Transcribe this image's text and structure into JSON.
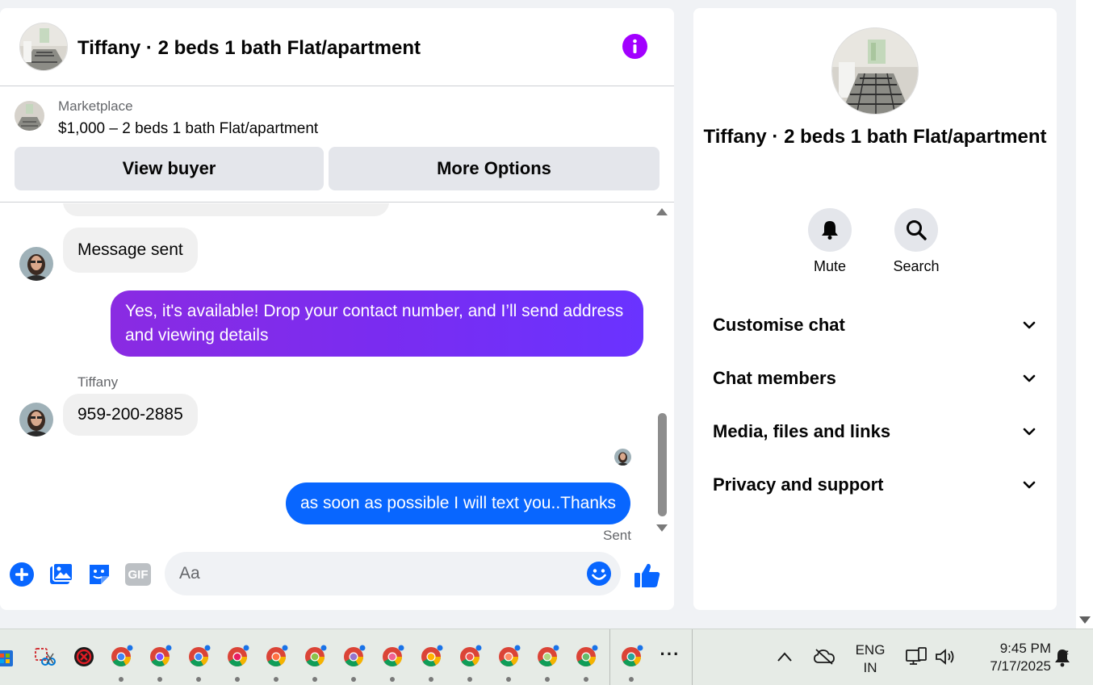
{
  "chat": {
    "title": "Tiffany · 2 beds 1 bath Flat/apartment",
    "info_icon": "info-icon",
    "marketplace": {
      "label": "Marketplace",
      "listing": "$1,000 – 2 beds 1 bath Flat/apartment",
      "view_buyer": "View buyer",
      "more_options": "More Options"
    },
    "messages": [
      {
        "direction": "in",
        "text": "Message sent"
      },
      {
        "direction": "out",
        "text": "Yes, it's available! Drop your contact number, and I’ll send address and viewing details"
      },
      {
        "direction": "in",
        "sender": "Tiffany",
        "text": "959-200-2885"
      },
      {
        "direction": "out",
        "text": "as soon as possible I will text you..Thanks",
        "status": "Sent"
      }
    ],
    "composer": {
      "placeholder": "Aa",
      "icons": [
        "plus-icon",
        "photo-icon",
        "sticker-icon",
        "gif-icon",
        "emoji-icon",
        "thumbs-up-icon"
      ],
      "gif_label": "GIF"
    }
  },
  "info_panel": {
    "title": "Tiffany · 2 beds 1 bath Flat/apartment",
    "actions": [
      {
        "label": "Mute",
        "icon": "bell-icon"
      },
      {
        "label": "Search",
        "icon": "search-icon"
      }
    ],
    "sections": [
      "Customise chat",
      "Chat members",
      "Media, files and links",
      "Privacy and support"
    ]
  },
  "taskbar": {
    "language_line1": "ENG",
    "language_line2": "IN",
    "time": "9:45 PM",
    "date": "7/17/2025",
    "overflow": "···"
  },
  "colors": {
    "accent_purple": "#a200ff",
    "outgoing_blue": "#0866ff",
    "incoming_gray": "#f0f0f0",
    "button_gray": "#e4e6eb"
  }
}
